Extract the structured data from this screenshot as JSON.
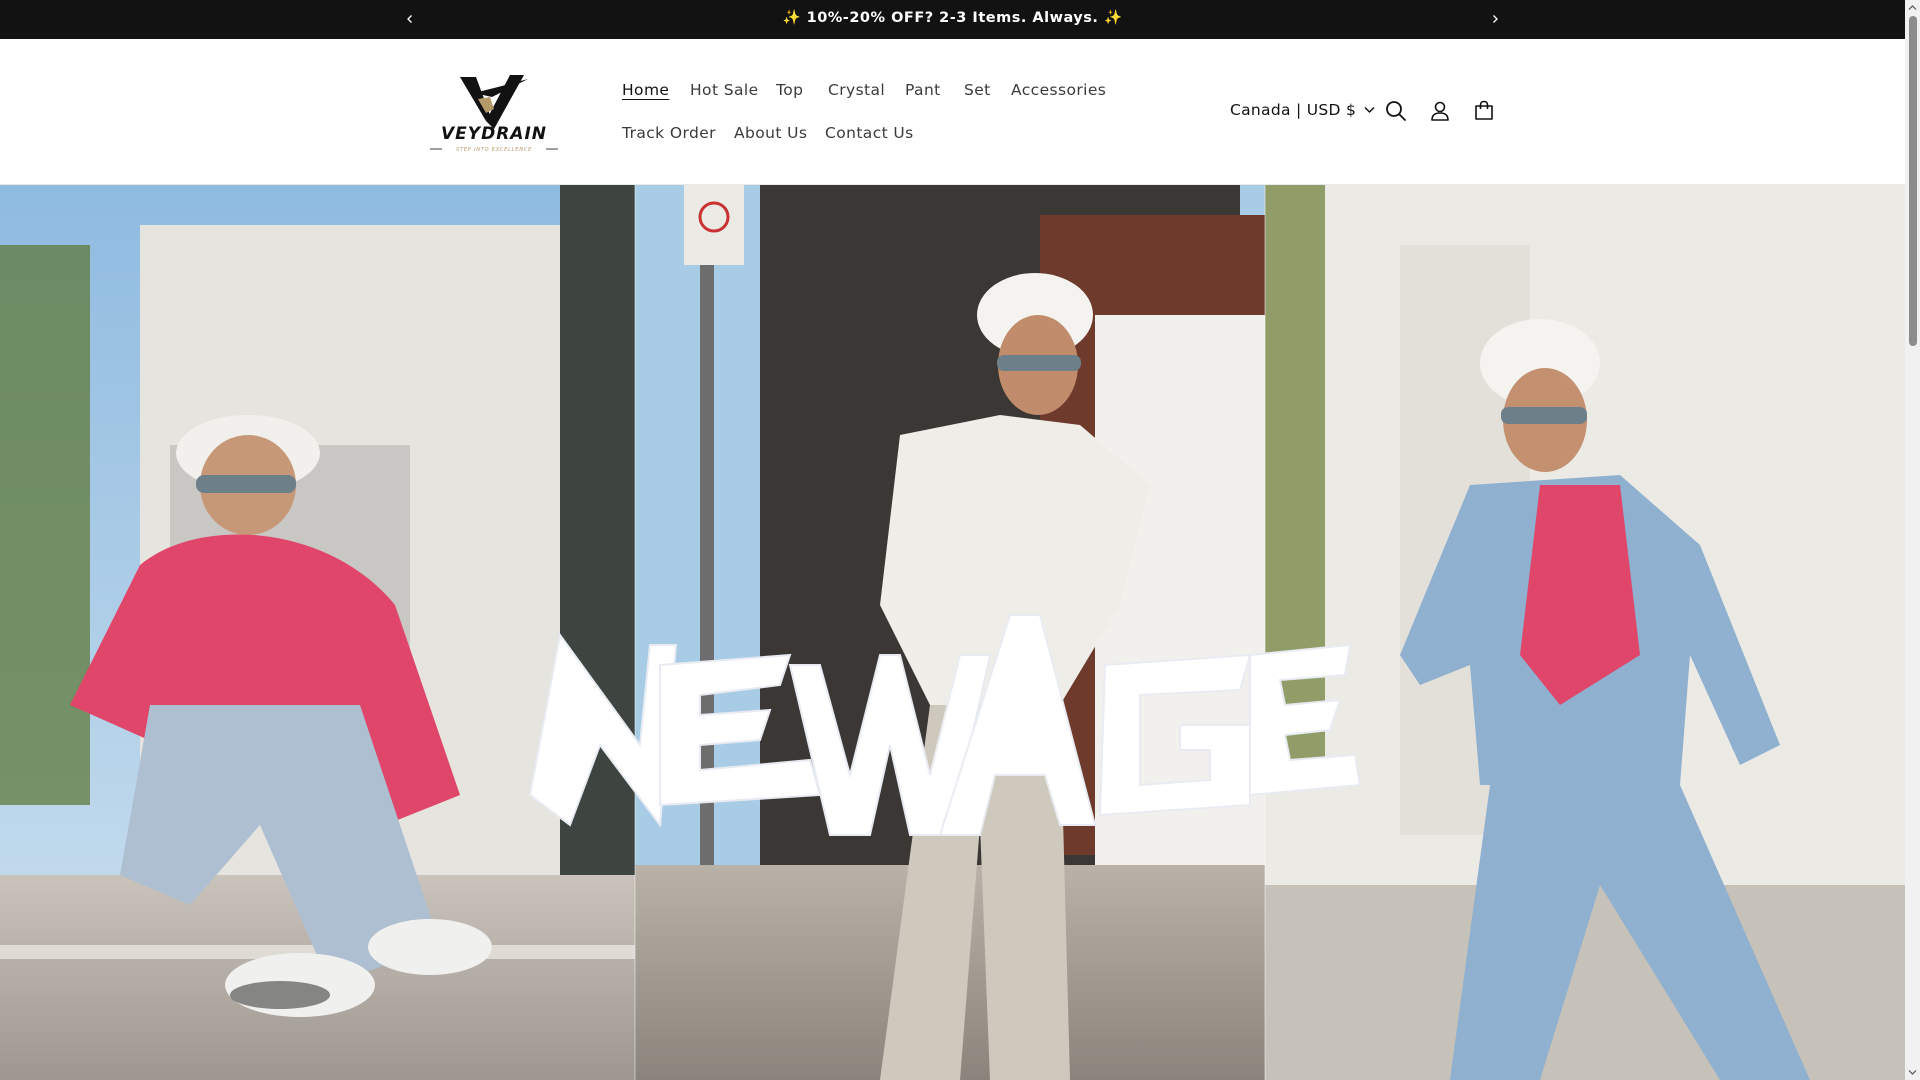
{
  "announcement": {
    "message": "✨ 10%-20% OFF? 2-3 Items. Always. ✨",
    "prev_icon": "chevron-left-icon",
    "next_icon": "chevron-right-icon"
  },
  "header": {
    "logo": {
      "brand": "VEYDRAIN",
      "tagline": "STEP INTO EXCELLENCE"
    },
    "nav": [
      {
        "label": "Home",
        "active": true
      },
      {
        "label": "Hot Sale"
      },
      {
        "label": "Top"
      },
      {
        "label": "Crystal"
      },
      {
        "label": "Pant"
      },
      {
        "label": "Set"
      },
      {
        "label": "Accessories"
      },
      {
        "label": "Track Order"
      },
      {
        "label": "About Us"
      },
      {
        "label": "Contact Us"
      }
    ],
    "country_selector": "Canada | USD $",
    "icons": {
      "search": "search-icon",
      "account": "account-icon",
      "cart": "cart-icon"
    }
  },
  "hero": {
    "headline": "NEWAGE"
  },
  "colors": {
    "announcement_bg": "#121212",
    "text": "#121212",
    "hoodie_pink": "#e0456a",
    "denim": "#8fb0cf",
    "sky": "#9cc3e2"
  }
}
